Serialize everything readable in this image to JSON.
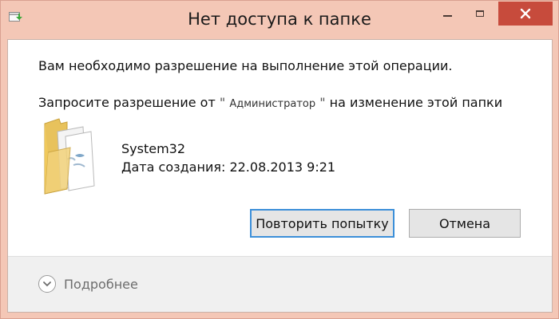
{
  "window": {
    "title": "Нет доступа к папке",
    "controls": {
      "minimize_icon": "minimize-icon",
      "maximize_icon": "maximize-icon",
      "close_icon": "close-icon"
    },
    "colors": {
      "frame": "#f4c7b6",
      "close_button": "#c74b3c",
      "default_button_border": "#3c8fd9"
    }
  },
  "dialog": {
    "message": "Вам необходимо разрешение на выполнение этой операции.",
    "request": {
      "prefix": "Запросите разрешение от",
      "quote_open": "\"",
      "principal": "Администратор",
      "quote_close": "\"",
      "suffix": "на изменение этой папки"
    },
    "item": {
      "icon": "folder-icon",
      "name": "System32",
      "created": "Дата создания: 22.08.2013 9:21"
    },
    "buttons": {
      "retry": "Повторить попытку",
      "cancel": "Отмена"
    },
    "footer": {
      "details_icon": "chevron-down-icon",
      "details_label": "Подробнее"
    }
  }
}
